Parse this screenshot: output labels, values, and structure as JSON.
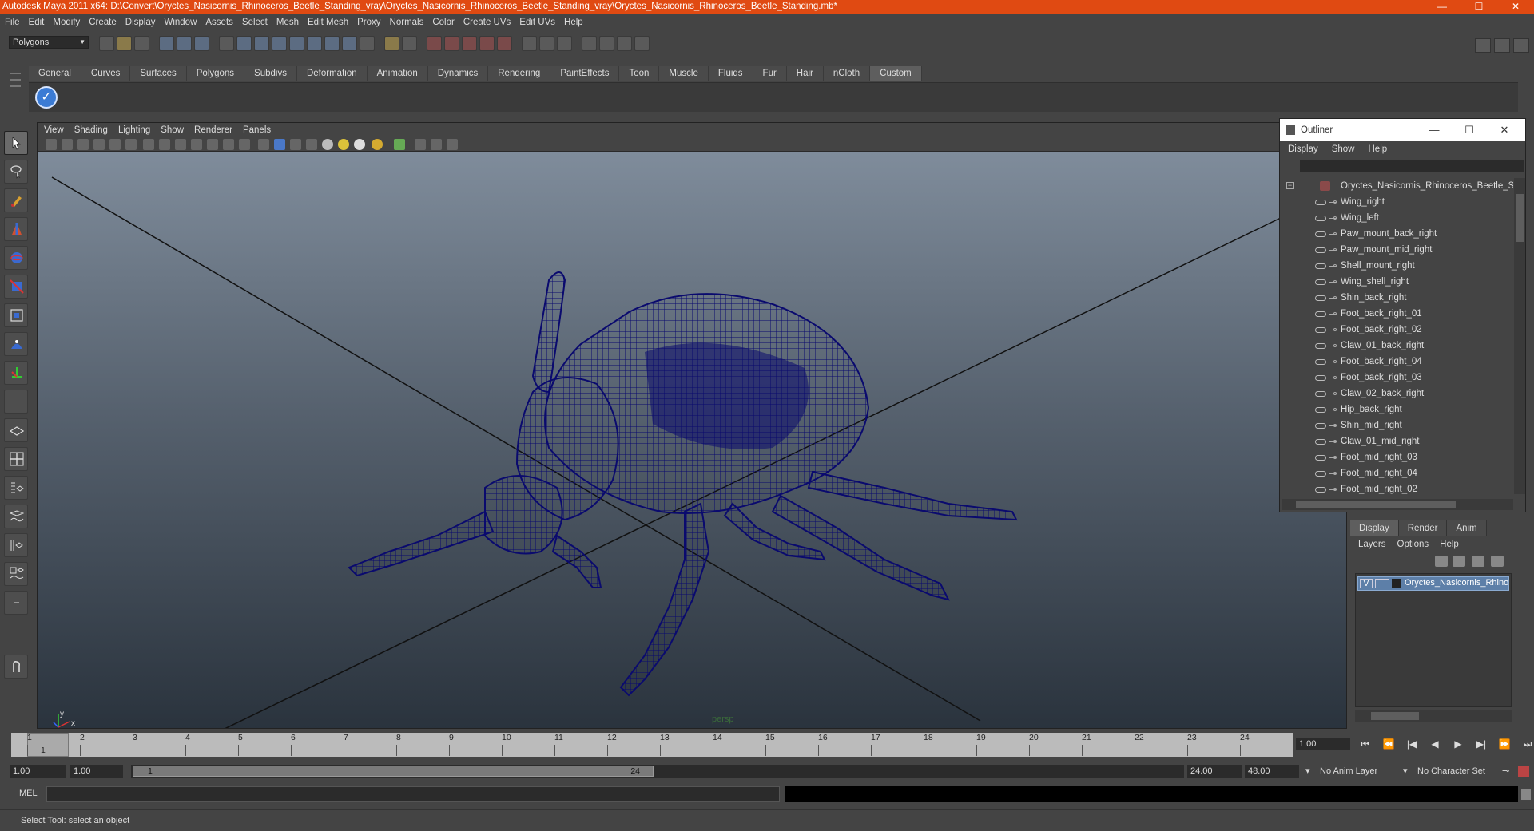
{
  "window": {
    "title": "Autodesk Maya 2011 x64: D:\\Convert\\Oryctes_Nasicornis_Rhinoceros_Beetle_Standing_vray\\Oryctes_Nasicornis_Rhinoceros_Beetle_Standing_vray\\Oryctes_Nasicornis_Rhinoceros_Beetle_Standing.mb*",
    "minimize": "—",
    "maximize": "☐",
    "close": "✕"
  },
  "menubar": [
    "File",
    "Edit",
    "Modify",
    "Create",
    "Display",
    "Window",
    "Assets",
    "Select",
    "Mesh",
    "Edit Mesh",
    "Proxy",
    "Normals",
    "Color",
    "Create UVs",
    "Edit UVs",
    "Help"
  ],
  "statusline": {
    "mode": "Polygons"
  },
  "shelf": {
    "tabs": [
      "General",
      "Curves",
      "Surfaces",
      "Polygons",
      "Subdivs",
      "Deformation",
      "Animation",
      "Dynamics",
      "Rendering",
      "PaintEffects",
      "Toon",
      "Muscle",
      "Fluids",
      "Fur",
      "Hair",
      "nCloth",
      "Custom"
    ],
    "active_tab": "Custom"
  },
  "viewport": {
    "menu": [
      "View",
      "Shading",
      "Lighting",
      "Show",
      "Renderer",
      "Panels"
    ],
    "camera": "persp",
    "axis_x": "x",
    "axis_y": "y",
    "wire_color": "#0a0a6e"
  },
  "outliner": {
    "title": "Outliner",
    "menu": [
      "Display",
      "Show",
      "Help"
    ],
    "root": "Oryctes_Nasicornis_Rhinoceros_Beetle_Standing",
    "items": [
      "Wing_right",
      "Wing_left",
      "Paw_mount_back_right",
      "Paw_mount_mid_right",
      "Shell_mount_right",
      "Wing_shell_right",
      "Shin_back_right",
      "Foot_back_right_01",
      "Foot_back_right_02",
      "Claw_01_back_right",
      "Foot_back_right_04",
      "Foot_back_right_03",
      "Claw_02_back_right",
      "Hip_back_right",
      "Shin_mid_right",
      "Claw_01_mid_right",
      "Foot_mid_right_03",
      "Foot_mid_right_04",
      "Foot_mid_right_02"
    ]
  },
  "layers": {
    "tabs": [
      "Display",
      "Render",
      "Anim"
    ],
    "active_tab": "Display",
    "menu": [
      "Layers",
      "Options",
      "Help"
    ],
    "layer_name": "Oryctes_Nasicornis_Rhinoceros_Beetle_Standing",
    "visibility": "V"
  },
  "timeline": {
    "ticks": [
      "1",
      "2",
      "3",
      "4",
      "5",
      "6",
      "7",
      "8",
      "9",
      "10",
      "11",
      "12",
      "13",
      "14",
      "15",
      "16",
      "17",
      "18",
      "19",
      "20",
      "21",
      "22",
      "23",
      "24"
    ],
    "current_frame_label": "1",
    "current_frame": "1.00",
    "playback": [
      "⏮",
      "⏪",
      "|◀",
      "◀",
      "▶",
      "▶|",
      "⏩",
      "⏭"
    ]
  },
  "range": {
    "start_time": "1.00",
    "playback_start": "1.00",
    "handle_start": "1",
    "handle_end": "24",
    "playback_end": "24.00",
    "end_time": "48.00",
    "anim_layer": "No Anim Layer",
    "character_set": "No Character Set"
  },
  "cmdline": {
    "label": "MEL"
  },
  "helpline": {
    "text": "Select Tool: select an object"
  }
}
